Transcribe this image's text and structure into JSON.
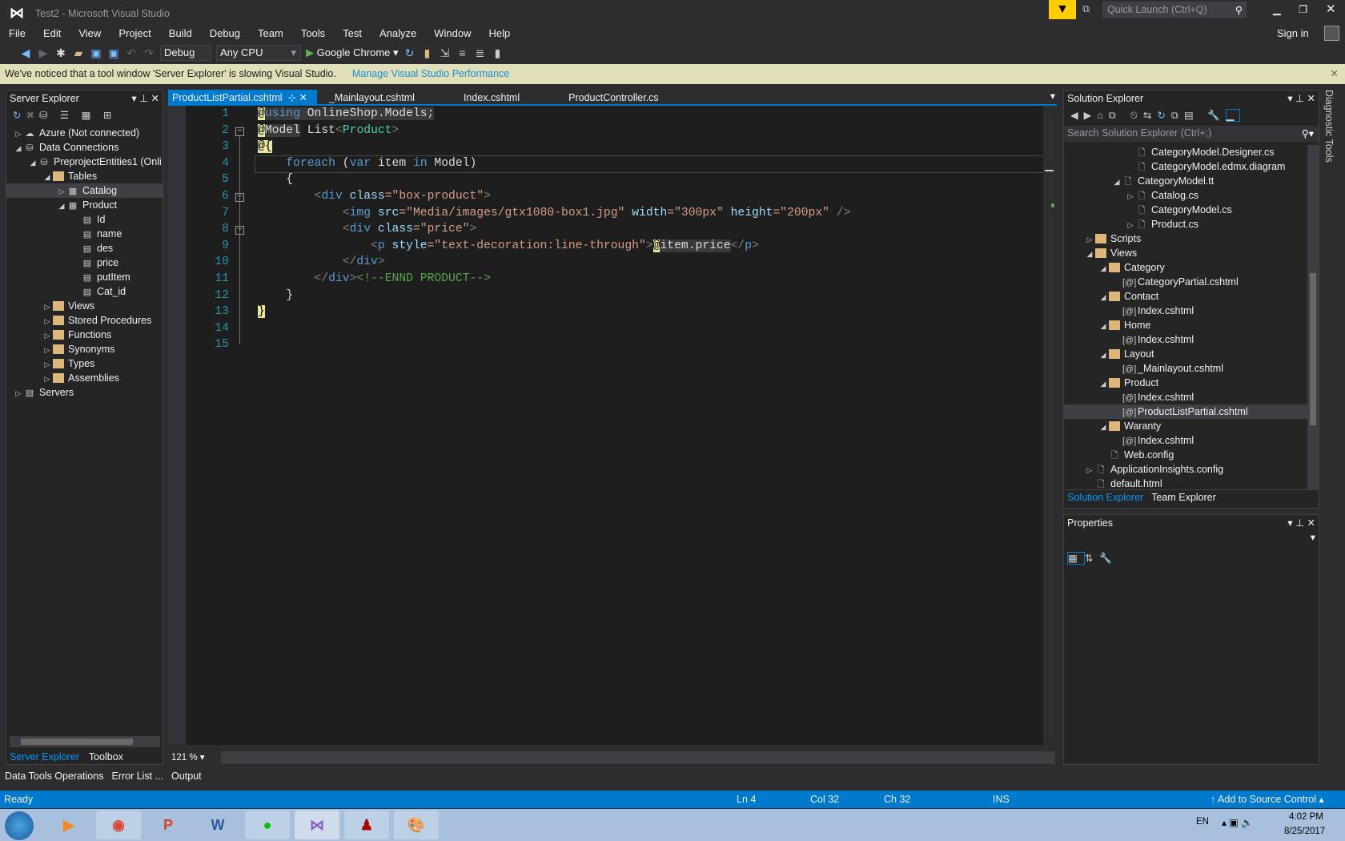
{
  "window": {
    "title": "Test2 - Microsoft Visual Studio",
    "quick_launch_placeholder": "Quick Launch (Ctrl+Q)",
    "sign_in": "Sign in"
  },
  "menu": [
    "File",
    "Edit",
    "View",
    "Project",
    "Build",
    "Debug",
    "Team",
    "Tools",
    "Test",
    "Analyze",
    "Window",
    "Help"
  ],
  "toolbar": {
    "config": "Debug",
    "platform": "Any CPU",
    "run_target": "Google Chrome"
  },
  "infobar": {
    "message": "We've noticed that a tool window 'Server Explorer' is slowing Visual Studio.",
    "link": "Manage Visual Studio Performance"
  },
  "server_explorer": {
    "title": "Server Explorer",
    "items": [
      {
        "label": "Azure (Not connected)",
        "depth": 0,
        "exp": "▷",
        "icon": "☁"
      },
      {
        "label": "Data Connections",
        "depth": 0,
        "exp": "◢",
        "icon": "⛁"
      },
      {
        "label": "PreprojectEntities1 (Onli",
        "depth": 1,
        "exp": "◢",
        "icon": "⛁"
      },
      {
        "label": "Tables",
        "depth": 2,
        "exp": "◢",
        "icon": "folder"
      },
      {
        "label": "Catalog",
        "depth": 3,
        "exp": "▷",
        "icon": "▦",
        "selected": true
      },
      {
        "label": "Product",
        "depth": 3,
        "exp": "◢",
        "icon": "▦"
      },
      {
        "label": "Id",
        "depth": 4,
        "exp": "",
        "icon": "▤"
      },
      {
        "label": "name",
        "depth": 4,
        "exp": "",
        "icon": "▤"
      },
      {
        "label": "des",
        "depth": 4,
        "exp": "",
        "icon": "▤"
      },
      {
        "label": "price",
        "depth": 4,
        "exp": "",
        "icon": "▤"
      },
      {
        "label": "putItem",
        "depth": 4,
        "exp": "",
        "icon": "▤"
      },
      {
        "label": "Cat_id",
        "depth": 4,
        "exp": "",
        "icon": "▤"
      },
      {
        "label": "Views",
        "depth": 2,
        "exp": "▷",
        "icon": "folder"
      },
      {
        "label": "Stored Procedures",
        "depth": 2,
        "exp": "▷",
        "icon": "folder"
      },
      {
        "label": "Functions",
        "depth": 2,
        "exp": "▷",
        "icon": "folder"
      },
      {
        "label": "Synonyms",
        "depth": 2,
        "exp": "▷",
        "icon": "folder"
      },
      {
        "label": "Types",
        "depth": 2,
        "exp": "▷",
        "icon": "folder"
      },
      {
        "label": "Assemblies",
        "depth": 2,
        "exp": "▷",
        "icon": "folder"
      },
      {
        "label": "Servers",
        "depth": 0,
        "exp": "▷",
        "icon": "▤"
      }
    ],
    "bottom_tabs": [
      "Server Explorer",
      "Toolbox"
    ]
  },
  "editor": {
    "tabs": [
      "ProductListPartial.cshtml",
      "_Mainlayout.cshtml",
      "Index.cshtml",
      "ProductController.cs"
    ],
    "zoom": "121 %",
    "lines": [
      [
        [
          "@",
          "razor"
        ],
        [
          "using",
          "kw hl"
        ],
        [
          " OnlineShop.Models;",
          "hl"
        ]
      ],
      [
        [
          "@",
          "razor"
        ],
        [
          "Model",
          "hl"
        ],
        [
          " List",
          ""
        ],
        [
          "<",
          "tag"
        ],
        [
          "Product",
          "ty"
        ],
        [
          ">",
          "tag"
        ]
      ],
      [
        [
          "@{",
          "razor"
        ]
      ],
      [
        [
          "    ",
          ""
        ],
        [
          "foreach",
          "kw"
        ],
        [
          " (",
          ""
        ],
        [
          "var",
          "kw"
        ],
        [
          " item ",
          ""
        ],
        [
          "in",
          "kw"
        ],
        [
          " Model)",
          ""
        ]
      ],
      [
        [
          "    {",
          ""
        ]
      ],
      [
        [
          "        ",
          ""
        ],
        [
          "<",
          "tag"
        ],
        [
          "div",
          "el"
        ],
        [
          " class",
          "at"
        ],
        [
          "=\"box-product\"",
          "str"
        ],
        [
          ">",
          "tag"
        ]
      ],
      [
        [
          "            ",
          ""
        ],
        [
          "<",
          "tag"
        ],
        [
          "img",
          "el"
        ],
        [
          " src",
          "at"
        ],
        [
          "=\"Media/images/gtx1080-box1.jpg\"",
          "str"
        ],
        [
          " width",
          "at"
        ],
        [
          "=\"300px\"",
          "str"
        ],
        [
          " height",
          "at"
        ],
        [
          "=\"200px\"",
          "str"
        ],
        [
          " />",
          "tag"
        ]
      ],
      [
        [
          "            ",
          ""
        ],
        [
          "<",
          "tag"
        ],
        [
          "div",
          "el"
        ],
        [
          " class",
          "at"
        ],
        [
          "=\"price\"",
          "str"
        ],
        [
          ">",
          "tag"
        ]
      ],
      [
        [
          "                ",
          ""
        ],
        [
          "<",
          "tag"
        ],
        [
          "p",
          "el"
        ],
        [
          " style",
          "at"
        ],
        [
          "=\"text-decoration:line-through\"",
          "str"
        ],
        [
          ">",
          "tag"
        ],
        [
          "@",
          "razor"
        ],
        [
          "item.price",
          "hl"
        ],
        [
          "</",
          "tag"
        ],
        [
          "p",
          "el"
        ],
        [
          ">",
          "tag"
        ]
      ],
      [
        [
          "            ",
          ""
        ],
        [
          "</",
          "tag"
        ],
        [
          "div",
          "el"
        ],
        [
          ">",
          "tag"
        ]
      ],
      [
        [
          "        ",
          ""
        ],
        [
          "</",
          "tag"
        ],
        [
          "div",
          "el"
        ],
        [
          ">",
          "tag"
        ],
        [
          "<!--ENND PRODUCT-->",
          "cm"
        ]
      ],
      [
        [
          "    }",
          ""
        ]
      ],
      [
        [
          "}",
          "razor"
        ]
      ],
      [],
      []
    ]
  },
  "solution_explorer": {
    "title": "Solution Explorer",
    "search_placeholder": "Search Solution Explorer (Ctrl+;)",
    "items": [
      {
        "label": "CategoryModel.Designer.cs",
        "depth": 4,
        "exp": "",
        "icon": "🗋"
      },
      {
        "label": "CategoryModel.edmx.diagram",
        "depth": 4,
        "exp": "",
        "icon": "🗋"
      },
      {
        "label": "CategoryModel.tt",
        "depth": 3,
        "exp": "◢",
        "icon": "🗋"
      },
      {
        "label": "Catalog.cs",
        "depth": 4,
        "exp": "▷",
        "icon": "🗋"
      },
      {
        "label": "CategoryModel.cs",
        "depth": 4,
        "exp": "",
        "icon": "🗋"
      },
      {
        "label": "Product.cs",
        "depth": 4,
        "exp": "▷",
        "icon": "🗋"
      },
      {
        "label": "Scripts",
        "depth": 1,
        "exp": "▷",
        "icon": "folder"
      },
      {
        "label": "Views",
        "depth": 1,
        "exp": "◢",
        "icon": "folder"
      },
      {
        "label": "Category",
        "depth": 2,
        "exp": "◢",
        "icon": "folder"
      },
      {
        "label": "CategoryPartial.cshtml",
        "depth": 3,
        "exp": "",
        "icon": "[@]"
      },
      {
        "label": "Contact",
        "depth": 2,
        "exp": "◢",
        "icon": "folder"
      },
      {
        "label": "Index.cshtml",
        "depth": 3,
        "exp": "",
        "icon": "[@]"
      },
      {
        "label": "Home",
        "depth": 2,
        "exp": "◢",
        "icon": "folder"
      },
      {
        "label": "Index.cshtml",
        "depth": 3,
        "exp": "",
        "icon": "[@]"
      },
      {
        "label": "Layout",
        "depth": 2,
        "exp": "◢",
        "icon": "folder"
      },
      {
        "label": "_Mainlayout.cshtml",
        "depth": 3,
        "exp": "",
        "icon": "[@]"
      },
      {
        "label": "Product",
        "depth": 2,
        "exp": "◢",
        "icon": "folder"
      },
      {
        "label": "Index.cshtml",
        "depth": 3,
        "exp": "",
        "icon": "[@]"
      },
      {
        "label": "ProductListPartial.cshtml",
        "depth": 3,
        "exp": "",
        "icon": "[@]",
        "selected": true
      },
      {
        "label": "Waranty",
        "depth": 2,
        "exp": "◢",
        "icon": "folder"
      },
      {
        "label": "Index.cshtml",
        "depth": 3,
        "exp": "",
        "icon": "[@]"
      },
      {
        "label": "Web.config",
        "depth": 2,
        "exp": "",
        "icon": "🗋"
      },
      {
        "label": "ApplicationInsights.config",
        "depth": 1,
        "exp": "▷",
        "icon": "🗋"
      },
      {
        "label": "default.html",
        "depth": 1,
        "exp": "",
        "icon": "🗋"
      }
    ],
    "bottom_tabs": [
      "Solution Explorer",
      "Team Explorer"
    ]
  },
  "diagnostic_tools": "Diagnostic Tools",
  "properties": {
    "title": "Properties"
  },
  "output_tabs": [
    "Data Tools Operations",
    "Error List ...",
    "Output"
  ],
  "status": {
    "ready": "Ready",
    "ln": "Ln 4",
    "col": "Col 32",
    "ch": "Ch 32",
    "mode": "INS",
    "source_control": "Add to Source Control"
  },
  "taskbar": {
    "apps": [
      "media-player",
      "chrome",
      "powerpoint",
      "word",
      "line",
      "visual-studio",
      "app-red",
      "paint"
    ],
    "lang": "EN",
    "time": "4:02 PM",
    "date": "8/25/2017"
  },
  "colors": {
    "accent": "#007acc",
    "infobar": "#e1dfb9",
    "editor_bg": "#1e1e1e"
  }
}
